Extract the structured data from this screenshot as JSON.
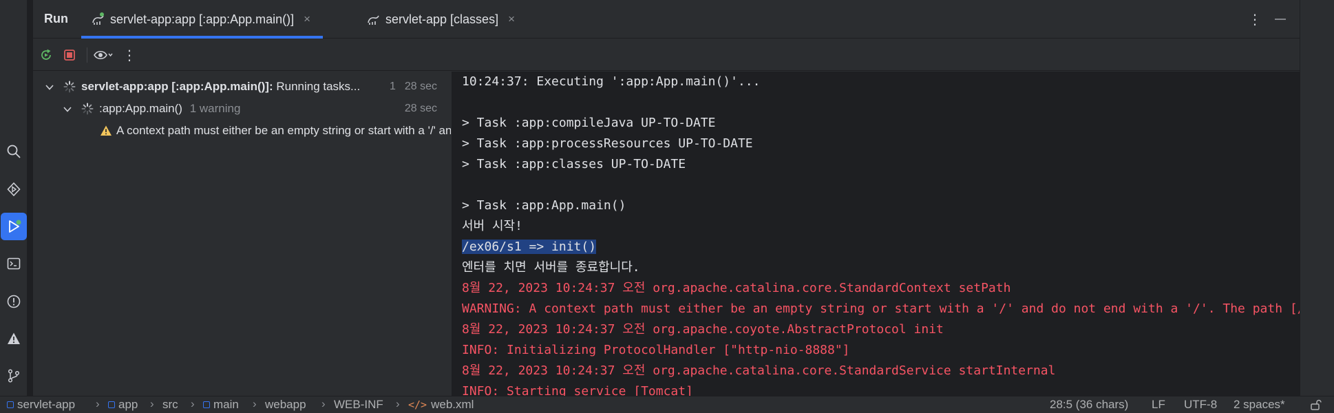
{
  "run_panel": {
    "title": "Run",
    "tabs": [
      {
        "label": "servlet-app:app [:app:App.main()]",
        "selected": true
      },
      {
        "label": "servlet-app [classes]",
        "selected": false
      }
    ],
    "close_glyph": "×",
    "more_glyph": "⋮",
    "minimize_glyph": "—"
  },
  "toolbar": {
    "icons": [
      "rerun-icon",
      "stop-icon",
      "eye-icon",
      "more-vertical-icon"
    ],
    "more_glyph": "⋮"
  },
  "tree": {
    "root": {
      "name": "servlet-app:app [:app:App.main()]:",
      "status": " Running tasks...",
      "count": "1",
      "time": "28 sec"
    },
    "child": {
      "name": ":app:App.main()",
      "warning_count": "1 warning",
      "time": "28 sec"
    },
    "warning": {
      "text": "A context path must either be an empty string or start with a '/' and do not end with a '/'."
    }
  },
  "console": {
    "lines": [
      {
        "text": "10:24:37: Executing ':app:App.main()'...",
        "kind": "normal"
      },
      {
        "text": "",
        "kind": "normal"
      },
      {
        "text": "> Task :app:compileJava UP-TO-DATE",
        "kind": "normal"
      },
      {
        "text": "> Task :app:processResources UP-TO-DATE",
        "kind": "normal"
      },
      {
        "text": "> Task :app:classes UP-TO-DATE",
        "kind": "normal"
      },
      {
        "text": "",
        "kind": "normal"
      },
      {
        "text": "> Task :app:App.main()",
        "kind": "normal"
      },
      {
        "text": "서버 시작!",
        "kind": "normal"
      },
      {
        "text": "/ex06/s1 => init()",
        "kind": "selected"
      },
      {
        "text": "엔터를 치면 서버를 종료합니다.",
        "kind": "normal"
      },
      {
        "text": "8월 22, 2023 10:24:37 오전 org.apache.catalina.core.StandardContext setPath",
        "kind": "error"
      },
      {
        "text": "WARNING: A context path must either be an empty string or start with a '/' and do not end with a '/'. The path [/] does not meet these criteria and has been changed to []",
        "kind": "error"
      },
      {
        "text": "8월 22, 2023 10:24:37 오전 org.apache.coyote.AbstractProtocol init",
        "kind": "error"
      },
      {
        "text": "INFO: Initializing ProtocolHandler [\"http-nio-8888\"]",
        "kind": "error"
      },
      {
        "text": "8월 22, 2023 10:24:37 오전 org.apache.catalina.core.StandardService startInternal",
        "kind": "error"
      },
      {
        "text": "INFO: Starting service [Tomcat]",
        "kind": "error"
      }
    ]
  },
  "left_toolbar": {
    "icons": [
      "search-icon",
      "services-icon",
      "run-icon",
      "terminal-icon",
      "problems-icon",
      "warning-icon",
      "git-icon"
    ],
    "active": "run-icon"
  },
  "status_bar": {
    "breadcrumbs": [
      {
        "label": "servlet-app",
        "icon": "module-icon"
      },
      {
        "label": "app",
        "icon": "module-icon"
      },
      {
        "label": "src",
        "icon": ""
      },
      {
        "label": "main",
        "icon": "module-icon"
      },
      {
        "label": "webapp",
        "icon": ""
      },
      {
        "label": "WEB-INF",
        "icon": ""
      },
      {
        "label": "web.xml",
        "icon": "xml-icon"
      }
    ],
    "separator": "›",
    "cursor": "28:5 (36 chars)",
    "line_ending": "LF",
    "encoding": "UTF-8",
    "indent": "2 spaces*"
  },
  "colors": {
    "accent": "#3574f0",
    "error_text": "#f75464",
    "selection": "#214283",
    "warning": "#f2c55c",
    "stop": "#db5c5c",
    "running_green": "#5fb865"
  }
}
